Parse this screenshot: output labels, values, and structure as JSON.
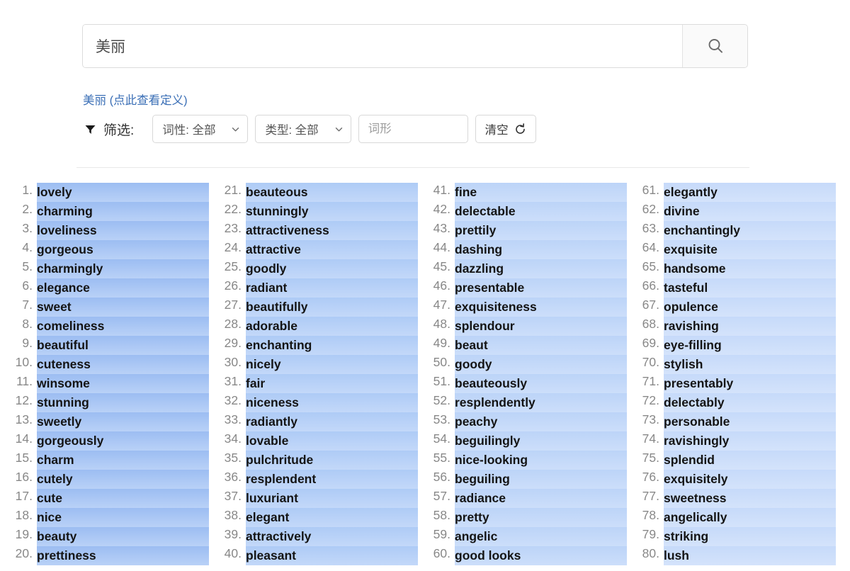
{
  "search": {
    "value": "美丽",
    "placeholder": "",
    "button_icon": "search-icon"
  },
  "definition_link": "美丽 (点此查看定义)",
  "filters": {
    "icon": "funnel-icon",
    "label": "筛选:",
    "pos_select": {
      "value": "词性: 全部",
      "icon": "chevron-down-icon"
    },
    "type_select": {
      "value": "类型: 全部",
      "icon": "chevron-down-icon"
    },
    "form_input": {
      "value": "",
      "placeholder": "词形"
    },
    "clear_button": {
      "label": "清空",
      "icon": "refresh-icon"
    }
  },
  "results": {
    "columns": [
      {
        "items": [
          {
            "n": "1.",
            "word": "lovely"
          },
          {
            "n": "2.",
            "word": "charming"
          },
          {
            "n": "3.",
            "word": "loveliness"
          },
          {
            "n": "4.",
            "word": "gorgeous"
          },
          {
            "n": "5.",
            "word": "charmingly"
          },
          {
            "n": "6.",
            "word": "elegance"
          },
          {
            "n": "7.",
            "word": "sweet"
          },
          {
            "n": "8.",
            "word": "comeliness"
          },
          {
            "n": "9.",
            "word": "beautiful"
          },
          {
            "n": "10.",
            "word": "cuteness"
          },
          {
            "n": "11.",
            "word": "winsome"
          },
          {
            "n": "12.",
            "word": "stunning"
          },
          {
            "n": "13.",
            "word": "sweetly"
          },
          {
            "n": "14.",
            "word": "gorgeously"
          },
          {
            "n": "15.",
            "word": "charm"
          },
          {
            "n": "16.",
            "word": "cutely"
          },
          {
            "n": "17.",
            "word": "cute"
          },
          {
            "n": "18.",
            "word": "nice"
          },
          {
            "n": "19.",
            "word": "beauty"
          },
          {
            "n": "20.",
            "word": "prettiness"
          }
        ]
      },
      {
        "items": [
          {
            "n": "21.",
            "word": "beauteous"
          },
          {
            "n": "22.",
            "word": "stunningly"
          },
          {
            "n": "23.",
            "word": "attractiveness"
          },
          {
            "n": "24.",
            "word": "attractive"
          },
          {
            "n": "25.",
            "word": "goodly"
          },
          {
            "n": "26.",
            "word": "radiant"
          },
          {
            "n": "27.",
            "word": "beautifully"
          },
          {
            "n": "28.",
            "word": "adorable"
          },
          {
            "n": "29.",
            "word": "enchanting"
          },
          {
            "n": "30.",
            "word": "nicely"
          },
          {
            "n": "31.",
            "word": "fair"
          },
          {
            "n": "32.",
            "word": "niceness"
          },
          {
            "n": "33.",
            "word": "radiantly"
          },
          {
            "n": "34.",
            "word": "lovable"
          },
          {
            "n": "35.",
            "word": "pulchritude"
          },
          {
            "n": "36.",
            "word": "resplendent"
          },
          {
            "n": "37.",
            "word": "luxuriant"
          },
          {
            "n": "38.",
            "word": "elegant"
          },
          {
            "n": "39.",
            "word": "attractively"
          },
          {
            "n": "40.",
            "word": "pleasant"
          }
        ]
      },
      {
        "items": [
          {
            "n": "41.",
            "word": "fine"
          },
          {
            "n": "42.",
            "word": "delectable"
          },
          {
            "n": "43.",
            "word": "prettily"
          },
          {
            "n": "44.",
            "word": "dashing"
          },
          {
            "n": "45.",
            "word": "dazzling"
          },
          {
            "n": "46.",
            "word": "presentable"
          },
          {
            "n": "47.",
            "word": "exquisiteness"
          },
          {
            "n": "48.",
            "word": "splendour"
          },
          {
            "n": "49.",
            "word": "beaut"
          },
          {
            "n": "50.",
            "word": "goody"
          },
          {
            "n": "51.",
            "word": "beauteously"
          },
          {
            "n": "52.",
            "word": "resplendently"
          },
          {
            "n": "53.",
            "word": "peachy"
          },
          {
            "n": "54.",
            "word": "beguilingly"
          },
          {
            "n": "55.",
            "word": "nice-looking"
          },
          {
            "n": "56.",
            "word": "beguiling"
          },
          {
            "n": "57.",
            "word": "radiance"
          },
          {
            "n": "58.",
            "word": "pretty"
          },
          {
            "n": "59.",
            "word": "angelic"
          },
          {
            "n": "60.",
            "word": "good looks"
          }
        ]
      },
      {
        "items": [
          {
            "n": "61.",
            "word": "elegantly"
          },
          {
            "n": "62.",
            "word": "divine"
          },
          {
            "n": "63.",
            "word": "enchantingly"
          },
          {
            "n": "64.",
            "word": "exquisite"
          },
          {
            "n": "65.",
            "word": "handsome"
          },
          {
            "n": "66.",
            "word": "tasteful"
          },
          {
            "n": "67.",
            "word": "opulence"
          },
          {
            "n": "68.",
            "word": "ravishing"
          },
          {
            "n": "69.",
            "word": "eye-filling"
          },
          {
            "n": "70.",
            "word": "stylish"
          },
          {
            "n": "71.",
            "word": "presentably"
          },
          {
            "n": "72.",
            "word": "delectably"
          },
          {
            "n": "73.",
            "word": "personable"
          },
          {
            "n": "74.",
            "word": "ravishingly"
          },
          {
            "n": "75.",
            "word": "splendid"
          },
          {
            "n": "76.",
            "word": "exquisitely"
          },
          {
            "n": "77.",
            "word": "sweetness"
          },
          {
            "n": "78.",
            "word": "angelically"
          },
          {
            "n": "79.",
            "word": "striking"
          },
          {
            "n": "80.",
            "word": "lush"
          }
        ]
      }
    ]
  },
  "colors": {
    "link": "#3b6fb6",
    "highlight_col1": "#9cbdf2",
    "highlight_col4": "#d4e3fb"
  }
}
